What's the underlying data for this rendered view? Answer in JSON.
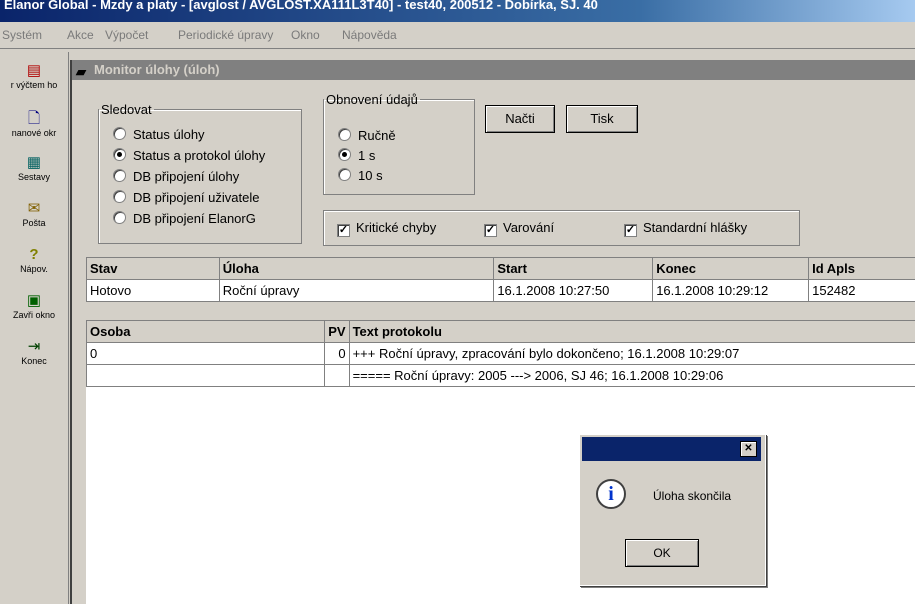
{
  "app": {
    "title": "Elanor Global - Mzdy a platy - [avglost / AVGLOST.XA111L3T40] - test40, 200512 - Dobírka, SJ. 40"
  },
  "menu": [
    "Systém",
    "Akce",
    "Výpočet",
    "Periodické úpravy",
    "Okno",
    "Nápověda"
  ],
  "toolbar": [
    {
      "label": "r výčtem ho",
      "icon": "list-icon",
      "glyph": "▤"
    },
    {
      "label": "nanové okr",
      "icon": "document-icon",
      "glyph": "🗋"
    },
    {
      "label": "Sestavy",
      "icon": "reports-icon",
      "glyph": "▦"
    },
    {
      "label": "Pošta",
      "icon": "mail-icon",
      "glyph": "✉"
    },
    {
      "label": "Nápov.",
      "icon": "help-icon",
      "glyph": "?"
    },
    {
      "label": "Zavři okno",
      "icon": "close-window-icon",
      "glyph": "▣"
    },
    {
      "label": "Konec",
      "icon": "exit-icon",
      "glyph": "⇥"
    }
  ],
  "window": {
    "title": "Monitor úlohy (úloh)"
  },
  "sledovat": {
    "legend": "Sledovat",
    "options": [
      "Status úlohy",
      "Status a protokol úlohy",
      "DB připojení úlohy",
      "DB připojení uživatele",
      "DB připojení ElanorG"
    ],
    "selected_index": 1
  },
  "obnoveni": {
    "legend": "Obnovení údajů",
    "options": [
      "Ručně",
      "1 s",
      "10 s"
    ],
    "selected_index": 1
  },
  "buttons": {
    "nacti": "Načti",
    "tisk": "Tisk"
  },
  "filters": [
    {
      "label": "Kritické chyby",
      "checked": true
    },
    {
      "label": "Varování",
      "checked": true
    },
    {
      "label": "Standardní hlášky",
      "checked": true
    }
  ],
  "tasks": {
    "headers": [
      "Stav",
      "Úloha",
      "Start",
      "Konec",
      "Id Apls"
    ],
    "rows": [
      [
        "Hotovo",
        "Roční úpravy",
        "16.1.2008 10:27:50",
        "16.1.2008 10:29:12",
        "152482"
      ]
    ]
  },
  "protocol": {
    "headers": [
      "Osoba",
      "PV",
      "Text protokolu"
    ],
    "rows": [
      [
        "0",
        "0",
        "+++ Roční úpravy, zpracování bylo dokončeno;  16.1.2008 10:29:07"
      ],
      [
        "",
        "",
        "===== Roční úpravy: 2005 ---> 2006, SJ 46;  16.1.2008 10:29:06"
      ]
    ]
  },
  "dialog": {
    "message": "Úloha skončila",
    "ok": "OK"
  }
}
